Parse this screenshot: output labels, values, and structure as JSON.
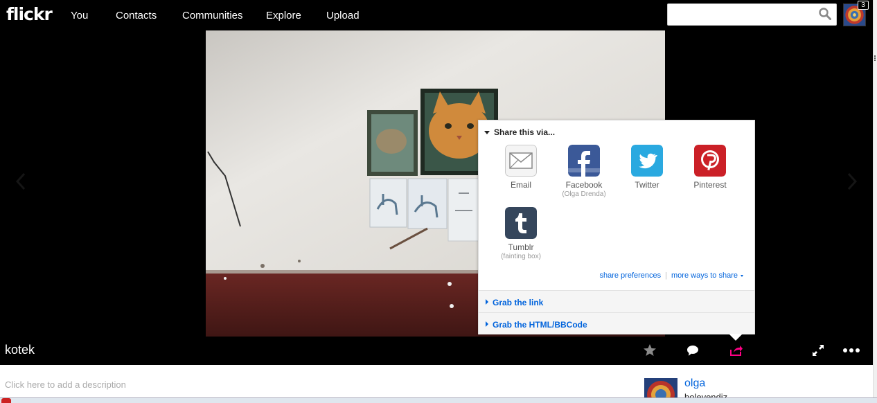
{
  "header": {
    "logo": "flickr",
    "nav": [
      "You",
      "Contacts",
      "Communities",
      "Explore",
      "Upload"
    ],
    "search": {
      "value": "",
      "placeholder": ""
    },
    "notification_count": "3"
  },
  "photo": {
    "title": "kotek",
    "description_prompt": "Click here to add a description"
  },
  "share": {
    "heading": "Share this via...",
    "services": [
      {
        "label": "Email",
        "sub": "",
        "icon": "email-icon",
        "color": "#f2f2f2"
      },
      {
        "label": "Facebook",
        "sub": "(Olga Drenda)",
        "icon": "facebook-icon",
        "color": "#3b5998"
      },
      {
        "label": "Twitter",
        "sub": "",
        "icon": "twitter-icon",
        "color": "#2aa9e0"
      },
      {
        "label": "Pinterest",
        "sub": "",
        "icon": "pinterest-icon",
        "color": "#cb2027"
      },
      {
        "label": "Tumblr",
        "sub": "(fainting box)",
        "icon": "tumblr-icon",
        "color": "#35465c"
      }
    ],
    "preferences_link": "share preferences",
    "more_link": "more ways to share",
    "grab_link": "Grab the link",
    "grab_html": "Grab the HTML/BBCode"
  },
  "owner": {
    "name": "olga",
    "subtitle": "boleyendiz"
  },
  "colors": {
    "link": "#0063dc",
    "share_active": "#ff0084"
  }
}
